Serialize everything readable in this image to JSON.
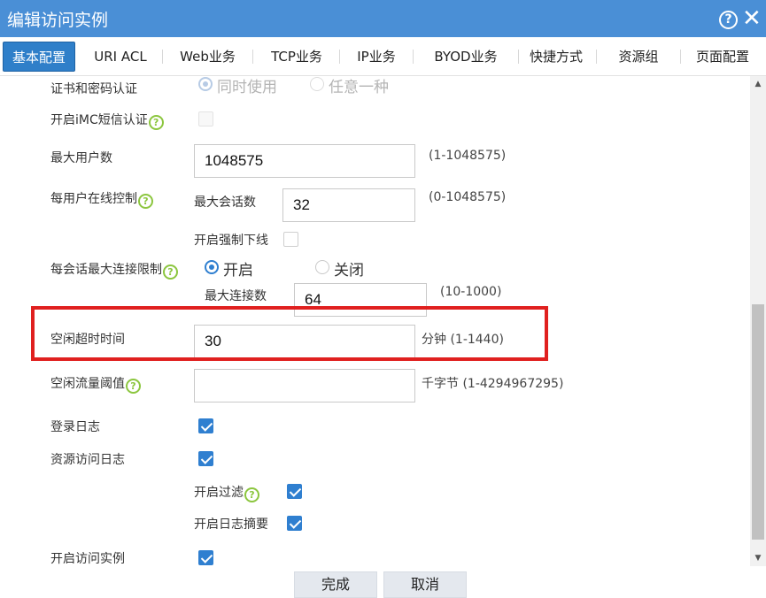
{
  "dialog": {
    "title": "编辑访问实例"
  },
  "tabs": [
    {
      "label": "基本配置",
      "active": true
    },
    {
      "label": "URI ACL"
    },
    {
      "label": "Web业务"
    },
    {
      "label": "TCP业务"
    },
    {
      "label": "IP业务"
    },
    {
      "label": "BYOD业务"
    },
    {
      "label": "快捷方式"
    },
    {
      "label": "资源组"
    },
    {
      "label": "页面配置"
    }
  ],
  "form": {
    "cert_auth": {
      "label": "证书和密码认证",
      "option_both": "同时使用",
      "option_any": "任意一种",
      "selected": "同时使用"
    },
    "imc_sms": {
      "label": "开启iMC短信认证",
      "checked": false
    },
    "max_users": {
      "label": "最大用户数",
      "value": "1048575",
      "hint": "(1-1048575)"
    },
    "per_user_online": {
      "label": "每用户在线控制",
      "max_sessions_label": "最大会话数",
      "max_sessions_value": "32",
      "max_sessions_hint": "(0-1048575)",
      "force_offline_label": "开启强制下线",
      "force_offline_checked": false
    },
    "per_session_conn_limit": {
      "label": "每会话最大连接限制",
      "option_on": "开启",
      "option_off": "关闭",
      "selected": "开启",
      "max_conn_label": "最大连接数",
      "max_conn_value": "64",
      "max_conn_hint": "(10-1000)"
    },
    "idle_timeout": {
      "label": "空闲超时时间",
      "value": "30",
      "hint": "分钟 (1-1440)"
    },
    "idle_traffic_threshold": {
      "label": "空闲流量阈值",
      "value": "",
      "hint": "千字节 (1-4294967295)"
    },
    "login_log": {
      "label": "登录日志",
      "checked": true
    },
    "resource_access_log": {
      "label": "资源访问日志",
      "checked": true,
      "filter_label": "开启过滤",
      "filter_checked": true,
      "summary_label": "开启日志摘要",
      "summary_checked": true
    },
    "enable_instance": {
      "label": "开启访问实例",
      "checked": true
    }
  },
  "footer": {
    "ok_label": "完成",
    "cancel_label": "取消"
  },
  "icons": {
    "help": "?",
    "close": "✕",
    "question": "?"
  },
  "colors": {
    "title_bar": "#4a8fd6",
    "active_tab": "#2f7fc9",
    "highlight_box": "#e0201f",
    "help_icon_green": "#8cc63f"
  }
}
